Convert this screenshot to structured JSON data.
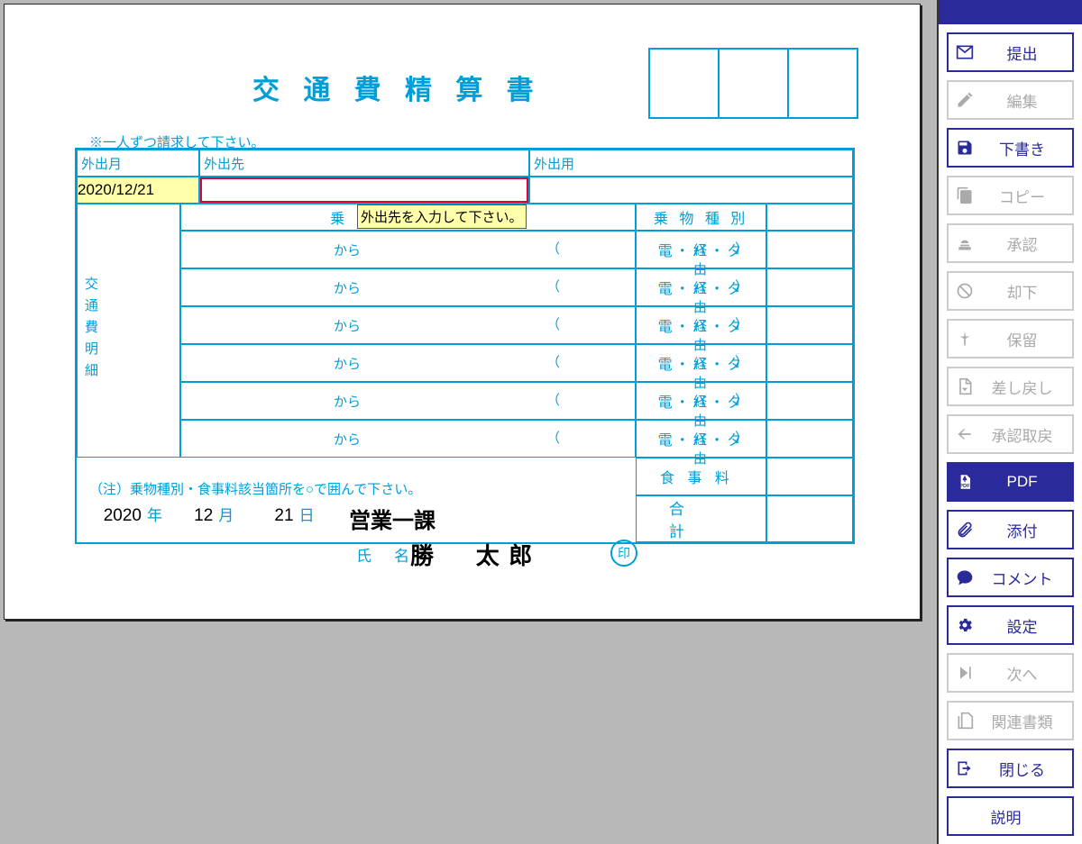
{
  "title": "交 通 費 精 算 書",
  "note_top": "※一人ずつ請求して下さい。",
  "note_bot": "（注）乗物種別・食事料該当箇所を○で囲んで下さい。",
  "tooltip": "外出先を入力して下さい。",
  "hdr": {
    "month": "外出月",
    "dest": "外出先",
    "purpose": "外出用",
    "ride": "乗　　　　車",
    "kbetu": "乗 物 種 別"
  },
  "date_value": "2020/12/21",
  "vlabel": "交通費明細",
  "ride": {
    "kara": "から",
    "p1": "（",
    "keiyu": "経由",
    "p2": "）"
  },
  "kbetu_txt": "電・バ・タ",
  "meal": "食事料",
  "total": "合　計",
  "footer": {
    "year": "2020",
    "ylab": "年",
    "month": "12",
    "mlab": "月",
    "day": "21",
    "dlab": "日"
  },
  "dept": "営業一課",
  "name_lab": "氏 名",
  "name": "勝　太郎",
  "seal": "印",
  "side": [
    {
      "key": "submit",
      "label": "提出",
      "disabled": false
    },
    {
      "key": "edit",
      "label": "編集",
      "disabled": true
    },
    {
      "key": "draft",
      "label": "下書き",
      "disabled": false
    },
    {
      "key": "copy",
      "label": "コピー",
      "disabled": true
    },
    {
      "key": "approve",
      "label": "承認",
      "disabled": true
    },
    {
      "key": "reject",
      "label": "却下",
      "disabled": true
    },
    {
      "key": "hold",
      "label": "保留",
      "disabled": true
    },
    {
      "key": "remand",
      "label": "差し戻し",
      "disabled": true
    },
    {
      "key": "cancel",
      "label": "承認取戻",
      "disabled": true
    },
    {
      "key": "pdf",
      "label": "PDF",
      "disabled": false,
      "reverse": true
    },
    {
      "key": "attach",
      "label": "添付",
      "disabled": false
    },
    {
      "key": "comment",
      "label": "コメント",
      "disabled": false
    },
    {
      "key": "settings",
      "label": "設定",
      "disabled": false
    },
    {
      "key": "next",
      "label": "次へ",
      "disabled": true
    },
    {
      "key": "related",
      "label": "関連書類",
      "disabled": true
    },
    {
      "key": "close",
      "label": "閉じる",
      "disabled": false
    },
    {
      "key": "help",
      "label": "説明",
      "disabled": false,
      "noicon": true
    }
  ]
}
